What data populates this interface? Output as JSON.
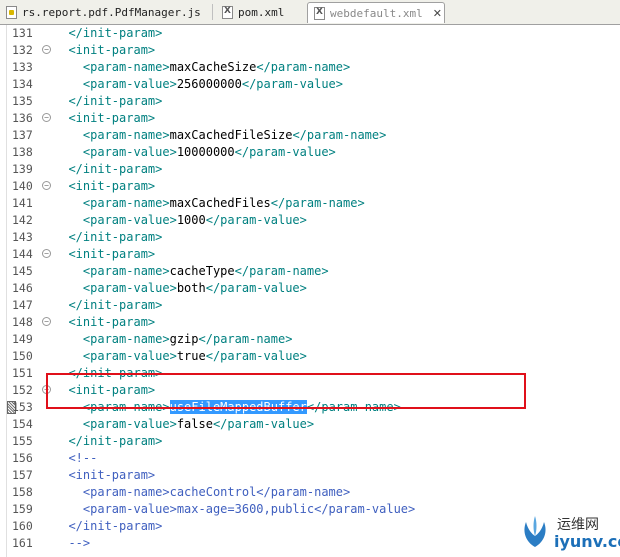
{
  "tabs": [
    {
      "label": "rs.report.pdf.PdfManager.js",
      "icon": "js-file-icon",
      "active": false
    },
    {
      "label": "pom.xml",
      "icon": "xml-file-icon",
      "active": false
    },
    {
      "label": "webdefault.xml",
      "icon": "xml-file-icon",
      "active": true,
      "close": "✕"
    }
  ],
  "lines": [
    {
      "n": "131",
      "fold": false,
      "indent": "  ",
      "parts": [
        [
          "t",
          "</init-param>"
        ]
      ]
    },
    {
      "n": "132",
      "fold": true,
      "indent": "  ",
      "parts": [
        [
          "t",
          "<init-param>"
        ]
      ]
    },
    {
      "n": "133",
      "fold": false,
      "indent": "    ",
      "parts": [
        [
          "t",
          "<param-name>"
        ],
        [
          "x",
          "maxCacheSize"
        ],
        [
          "t",
          "</param-name>"
        ]
      ]
    },
    {
      "n": "134",
      "fold": false,
      "indent": "    ",
      "parts": [
        [
          "t",
          "<param-value>"
        ],
        [
          "x",
          "256000000"
        ],
        [
          "t",
          "</param-value>"
        ]
      ]
    },
    {
      "n": "135",
      "fold": false,
      "indent": "  ",
      "parts": [
        [
          "t",
          "</init-param>"
        ]
      ]
    },
    {
      "n": "136",
      "fold": true,
      "indent": "  ",
      "parts": [
        [
          "t",
          "<init-param>"
        ]
      ]
    },
    {
      "n": "137",
      "fold": false,
      "indent": "    ",
      "parts": [
        [
          "t",
          "<param-name>"
        ],
        [
          "x",
          "maxCachedFileSize"
        ],
        [
          "t",
          "</param-name>"
        ]
      ]
    },
    {
      "n": "138",
      "fold": false,
      "indent": "    ",
      "parts": [
        [
          "t",
          "<param-value>"
        ],
        [
          "x",
          "10000000"
        ],
        [
          "t",
          "</param-value>"
        ]
      ]
    },
    {
      "n": "139",
      "fold": false,
      "indent": "  ",
      "parts": [
        [
          "t",
          "</init-param>"
        ]
      ]
    },
    {
      "n": "140",
      "fold": true,
      "indent": "  ",
      "parts": [
        [
          "t",
          "<init-param>"
        ]
      ]
    },
    {
      "n": "141",
      "fold": false,
      "indent": "    ",
      "parts": [
        [
          "t",
          "<param-name>"
        ],
        [
          "x",
          "maxCachedFiles"
        ],
        [
          "t",
          "</param-name>"
        ]
      ]
    },
    {
      "n": "142",
      "fold": false,
      "indent": "    ",
      "parts": [
        [
          "t",
          "<param-value>"
        ],
        [
          "x",
          "1000"
        ],
        [
          "t",
          "</param-value>"
        ]
      ]
    },
    {
      "n": "143",
      "fold": false,
      "indent": "  ",
      "parts": [
        [
          "t",
          "</init-param>"
        ]
      ]
    },
    {
      "n": "144",
      "fold": true,
      "indent": "  ",
      "parts": [
        [
          "t",
          "<init-param>"
        ]
      ]
    },
    {
      "n": "145",
      "fold": false,
      "indent": "    ",
      "parts": [
        [
          "t",
          "<param-name>"
        ],
        [
          "x",
          "cacheType"
        ],
        [
          "t",
          "</param-name>"
        ]
      ]
    },
    {
      "n": "146",
      "fold": false,
      "indent": "    ",
      "parts": [
        [
          "t",
          "<param-value>"
        ],
        [
          "x",
          "both"
        ],
        [
          "t",
          "</param-value>"
        ]
      ]
    },
    {
      "n": "147",
      "fold": false,
      "indent": "  ",
      "parts": [
        [
          "t",
          "</init-param>"
        ]
      ]
    },
    {
      "n": "148",
      "fold": true,
      "indent": "  ",
      "parts": [
        [
          "t",
          "<init-param>"
        ]
      ]
    },
    {
      "n": "149",
      "fold": false,
      "indent": "    ",
      "parts": [
        [
          "t",
          "<param-name>"
        ],
        [
          "x",
          "gzip"
        ],
        [
          "t",
          "</param-name>"
        ]
      ]
    },
    {
      "n": "150",
      "fold": false,
      "indent": "    ",
      "parts": [
        [
          "t",
          "<param-value>"
        ],
        [
          "x",
          "true"
        ],
        [
          "t",
          "</param-value>"
        ]
      ]
    },
    {
      "n": "151",
      "fold": false,
      "indent": "  ",
      "parts": [
        [
          "t",
          "</init-param>"
        ]
      ]
    },
    {
      "n": "152",
      "fold": true,
      "indent": "  ",
      "parts": [
        [
          "t",
          "<init-param>"
        ]
      ]
    },
    {
      "n": "153",
      "fold": false,
      "indent": "    ",
      "mark": true,
      "parts": [
        [
          "t",
          "<param-name>"
        ],
        [
          "hl",
          "useFileMappedBuffer"
        ],
        [
          "t",
          "</param-name>"
        ]
      ]
    },
    {
      "n": "154",
      "fold": false,
      "indent": "    ",
      "parts": [
        [
          "t",
          "<param-value>"
        ],
        [
          "x",
          "false"
        ],
        [
          "t",
          "</param-value>"
        ]
      ]
    },
    {
      "n": "155",
      "fold": false,
      "indent": "  ",
      "parts": [
        [
          "t",
          "</init-param>"
        ]
      ]
    },
    {
      "n": "156",
      "fold": false,
      "indent": "  ",
      "parts": [
        [
          "c",
          "<!--"
        ]
      ]
    },
    {
      "n": "157",
      "fold": false,
      "indent": "  ",
      "parts": [
        [
          "c",
          "<init-param>"
        ]
      ]
    },
    {
      "n": "158",
      "fold": false,
      "indent": "    ",
      "parts": [
        [
          "c",
          "<param-name>cacheControl</param-name>"
        ]
      ]
    },
    {
      "n": "159",
      "fold": false,
      "indent": "    ",
      "parts": [
        [
          "c",
          "<param-value>max-age=3600,public</param-value>"
        ]
      ]
    },
    {
      "n": "160",
      "fold": false,
      "indent": "  ",
      "parts": [
        [
          "c",
          "</init-param>"
        ]
      ]
    },
    {
      "n": "161",
      "fold": false,
      "indent": "  ",
      "parts": [
        [
          "c",
          "-->"
        ]
      ]
    }
  ],
  "watermark": {
    "name": "运维网",
    "url": "iyunv.com"
  },
  "colors": {
    "tag": "#008080",
    "comment": "#3f5fbf",
    "selection": "#3399ff",
    "annotation_box": "#e0101a"
  }
}
